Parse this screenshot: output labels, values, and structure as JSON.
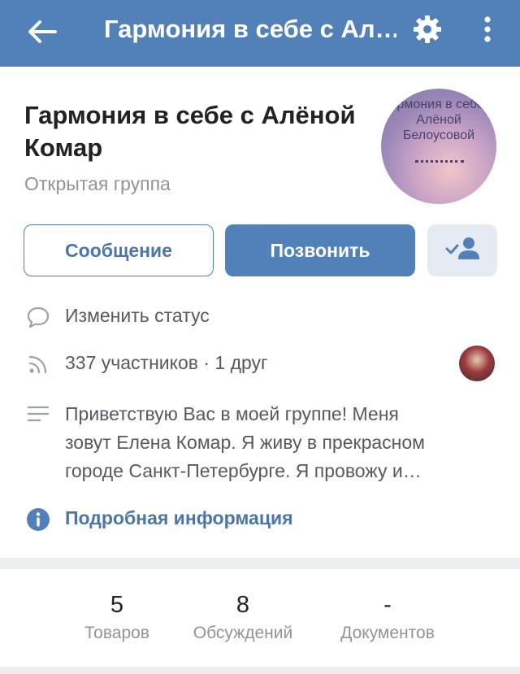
{
  "header": {
    "title": "Гармония в себе с Ал…"
  },
  "group": {
    "name": "Гармония в себе с Алёной Комар",
    "type": "Открытая группа",
    "avatar_text": "Гармония в себе с Алёной Белоусовой"
  },
  "actions": {
    "message_label": "Сообщение",
    "call_label": "Позвонить"
  },
  "info": {
    "status_label": "Изменить статус",
    "members_text": "337 участников · 1 друг",
    "description": "Приветствую Вас в моей группе!     Меня\nзовут Елена Комар. Я живу в прекрасном\nгороде Санкт-Петербурге.     Я провожу и…",
    "details_label": "Подробная информация"
  },
  "stats": [
    {
      "value": "5",
      "label": "Товаров"
    },
    {
      "value": "8",
      "label": "Обсуждений"
    },
    {
      "value": "-",
      "label": "Документов"
    }
  ],
  "colors": {
    "accent": "#5181b8",
    "link": "#4a76a8",
    "muted": "#909499"
  },
  "icons": {
    "back": "arrow-left-icon",
    "settings": "gear-icon",
    "more": "more-vertical-icon",
    "member": "member-check-icon",
    "status": "speech-bubble-icon",
    "members": "rss-icon",
    "description": "text-lines-icon",
    "details": "info-icon"
  }
}
